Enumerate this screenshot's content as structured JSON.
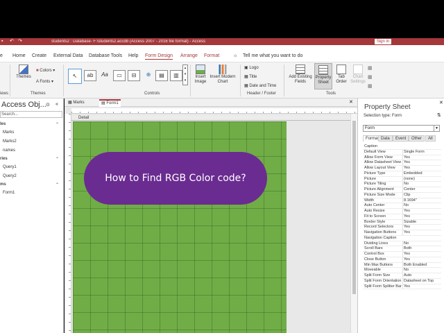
{
  "window": {
    "title": "students2 : Database- F:\\students2.accdb (Access 2007 - 2016 file format) - Access",
    "signin_label": "Sign in"
  },
  "menu": {
    "items": [
      "Home",
      "Create",
      "External Data",
      "Database Tools",
      "Help",
      "Form Design",
      "Arrange",
      "Format"
    ],
    "tell_me": "Tell me what you want to do"
  },
  "ribbon": {
    "themes_label": "Themes",
    "colors_label": "Colors",
    "fonts_label": "Fonts",
    "group_themes": "Themes",
    "group_controls": "Controls",
    "insert_image": "Insert Image",
    "insert_modern_chart": "Insert Modern Chart",
    "logo": "Logo",
    "title": "Title",
    "date_time": "Date and Time",
    "group_header_footer": "Header / Footer",
    "add_existing_fields": "Add Existing Fields",
    "property_sheet": "Property Sheet",
    "tab_order": "Tab Order",
    "chart_settings": "Chart Settings",
    "group_tools": "Tools",
    "views_fragment": "iews"
  },
  "nav": {
    "title": "Access Obj...",
    "search_placeholder": "Search...",
    "groups": [
      {
        "label": "les",
        "items": [
          "Marks",
          "Marks2",
          "names"
        ]
      },
      {
        "label": "ries",
        "items": [
          "Query1",
          "Query2"
        ]
      },
      {
        "label": "ms",
        "items": [
          "Form1"
        ]
      }
    ]
  },
  "doc": {
    "tabs": [
      "Marks",
      "Form1"
    ],
    "section": "Detail",
    "pill_text": "How to Find RGB Color code?"
  },
  "props": {
    "title": "Property Sheet",
    "selection_type": "Selection type:  Form",
    "selected": "Form",
    "tabs": [
      "Format",
      "Data",
      "Event",
      "Other",
      "All"
    ],
    "rows": [
      [
        "Caption",
        ""
      ],
      [
        "Default View",
        "Single Form"
      ],
      [
        "Allow Form View",
        "Yes"
      ],
      [
        "Allow Datasheet View",
        "Yes"
      ],
      [
        "Allow Layout View",
        "Yes"
      ],
      [
        "Picture Type",
        "Embedded"
      ],
      [
        "Picture",
        "(none)"
      ],
      [
        "Picture Tiling",
        "No"
      ],
      [
        "Picture Alignment",
        "Center"
      ],
      [
        "Picture Size Mode",
        "Clip"
      ],
      [
        "Width",
        "8.1694\""
      ],
      [
        "Auto Center",
        "No"
      ],
      [
        "Auto Resize",
        "Yes"
      ],
      [
        "Fit to Screen",
        "Yes"
      ],
      [
        "Border Style",
        "Sizable"
      ],
      [
        "Record Selectors",
        "Yes"
      ],
      [
        "Navigation Buttons",
        "Yes"
      ],
      [
        "Navigation Caption",
        ""
      ],
      [
        "Dividing Lines",
        "No"
      ],
      [
        "Scroll Bars",
        "Both"
      ],
      [
        "Control Box",
        "Yes"
      ],
      [
        "Close Button",
        "Yes"
      ],
      [
        "Min Max Buttons",
        "Both Enabled"
      ],
      [
        "Moveable",
        "No"
      ],
      [
        "Split Form Size",
        "Auto"
      ],
      [
        "Split Form Orientation",
        "Datasheet on Top"
      ],
      [
        "Split Form Splitter Bar",
        "Yes"
      ]
    ]
  },
  "colors": {
    "accent": "#a4373a",
    "canvas": "#70ad47",
    "pill": "#6a2c91"
  }
}
